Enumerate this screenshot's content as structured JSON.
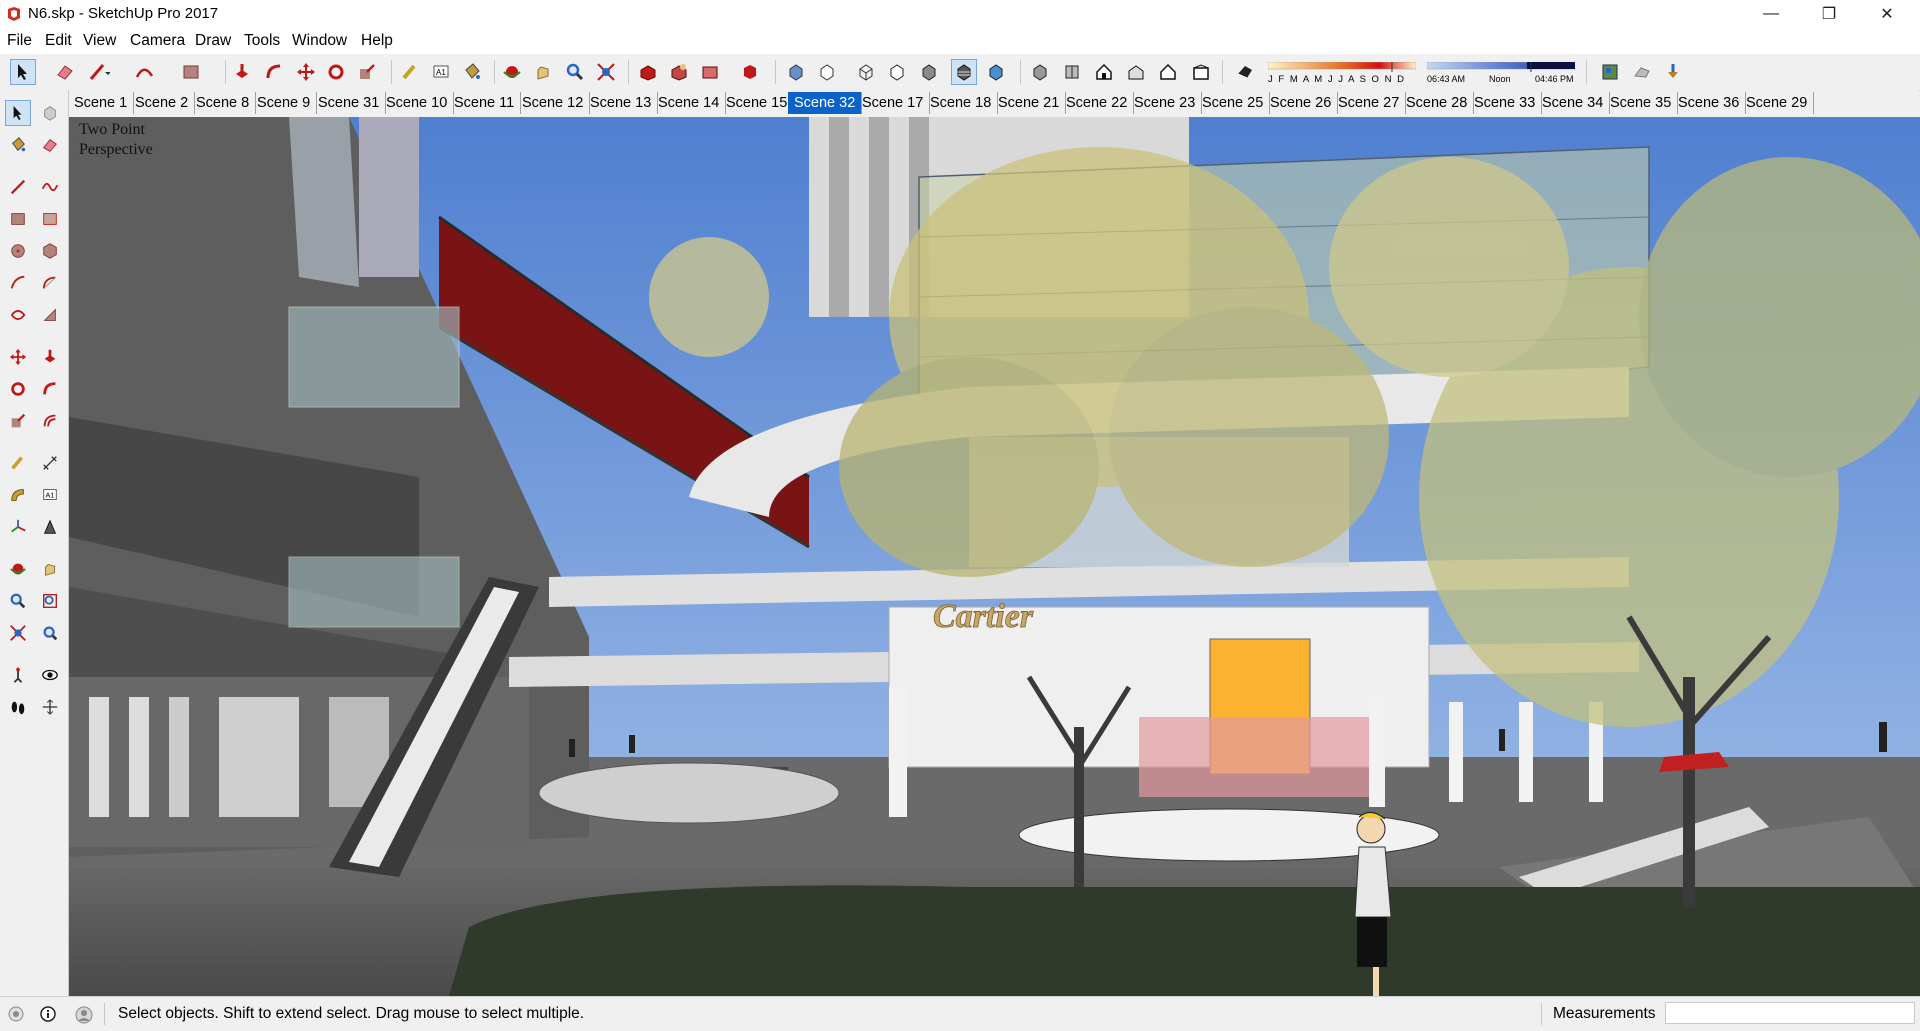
{
  "window": {
    "title": "N6.skp - SketchUp Pro 2017",
    "app_icon": "sketchup-logo-icon",
    "controls": [
      "minimize-icon",
      "restore-icon",
      "close-icon"
    ]
  },
  "menu": [
    "File",
    "Edit",
    "View",
    "Camera",
    "Draw",
    "Tools",
    "Window",
    "Help"
  ],
  "shadow_settings": {
    "months": "J F M A M J J A S O N D",
    "sunrise_time": "06:43 AM",
    "noon_label": "Noon",
    "sunset_time": "04:46 PM"
  },
  "scenes": {
    "active": "Scene 32",
    "tabs": [
      "Scene 1",
      "Scene 2",
      "Scene 8",
      "Scene 9",
      "Scene 31",
      "Scene 10",
      "Scene 11",
      "Scene 12",
      "Scene 13",
      "Scene 14",
      "Scene 15",
      "Scene 32",
      "Scene 17",
      "Scene 18",
      "Scene 21",
      "Scene 22",
      "Scene 23",
      "Scene 25",
      "Scene 26",
      "Scene 27",
      "Scene 28",
      "Scene 33",
      "Scene 34",
      "Scene 35",
      "Scene 36",
      "Scene 29"
    ]
  },
  "viewport": {
    "camera_label_line1": "Two Point",
    "camera_label_line2": "Perspective",
    "storefront_sign": "Cartier"
  },
  "status": {
    "message": "Select objects. Shift to extend select. Drag mouse to select multiple.",
    "measurements_label": "Measurements",
    "measurements_value": ""
  },
  "colors": {
    "accent": "#0a64c8",
    "sky": "#5f8fd6",
    "bridge_red": "#7a1414",
    "foliage": "#c9c07a"
  }
}
